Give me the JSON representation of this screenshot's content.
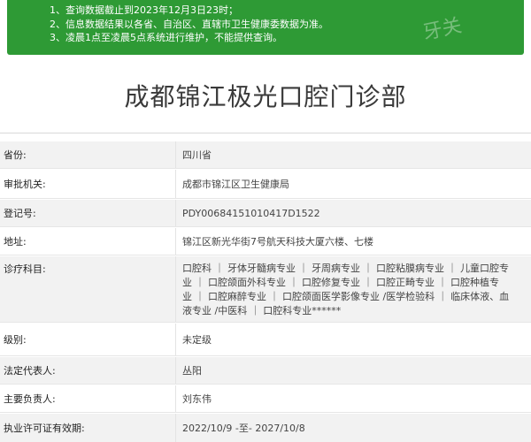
{
  "notice": {
    "lines": [
      "1、查询数据截止到2023年12月3日23时；",
      "2、信息数据结果以各省、自治区、直辖市卫生健康委数据为准。",
      "3、凌晨1点至凌晨5点系统进行维护，不能提供查询。"
    ],
    "watermark": "牙关"
  },
  "title": "成都锦江极光口腔门诊部",
  "details": [
    {
      "label": "省份:",
      "value": "四川省"
    },
    {
      "label": "审批机关:",
      "value": "成都市锦江区卫生健康局"
    },
    {
      "label": "登记号:",
      "value": "PDY00684151010417D1522"
    },
    {
      "label": "地址:",
      "value": "锦江区新光华街7号航天科技大厦六楼、七楼"
    },
    {
      "label": "诊疗科目:",
      "value_lines": [
        "口腔科 ｜ 牙体牙髓病专业 ｜ 牙周病专业 ｜ 口腔粘膜病专业 ｜ 儿童口腔专",
        "业 ｜ 口腔颌面外科专业 ｜ 口腔修复专业 ｜ 口腔正畸专业 ｜ 口腔种植专",
        "业 ｜ 口腔麻醉专业 ｜ 口腔颌面医学影像专业 /医学检验科 ｜ 临床体液、血",
        "液专业 /中医科 ｜ 口腔科专业******"
      ]
    },
    {
      "label": "级别:",
      "value": "未定级"
    },
    {
      "label": "法定代表人:",
      "value": "丛阳"
    },
    {
      "label": "主要负责人:",
      "value": "刘东伟"
    },
    {
      "label": "执业许可证有效期:",
      "value": "2022/10/9 -至- 2027/10/8"
    }
  ]
}
